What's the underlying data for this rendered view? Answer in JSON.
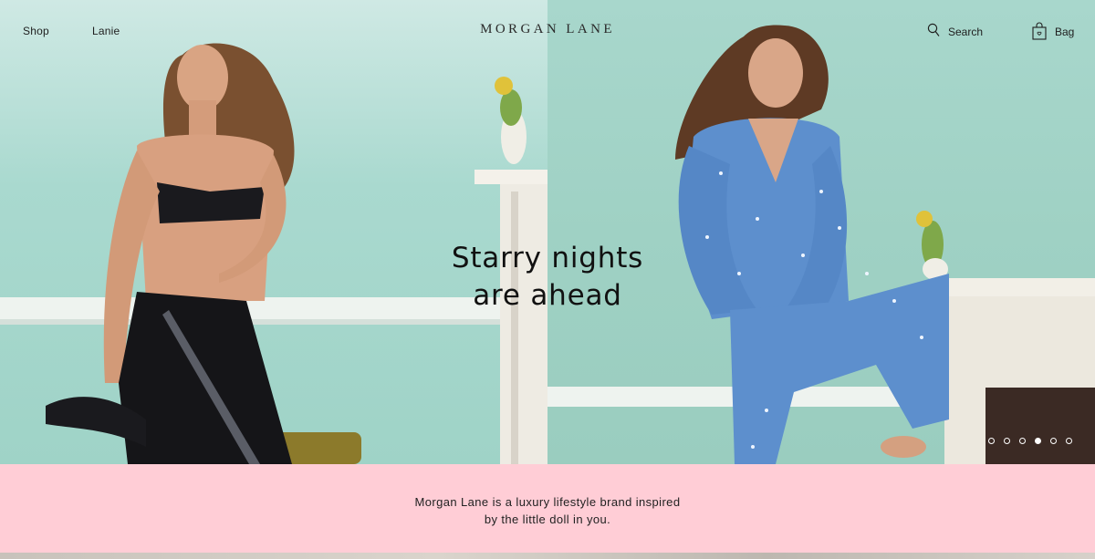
{
  "nav": {
    "shop_label": "Shop",
    "lanie_label": "Lanie",
    "logo_text": "MORGAN LANE",
    "search_label": "Search",
    "bag_label": "Bag",
    "search_icon": "search-icon",
    "bag_icon": "bag-icon"
  },
  "hero": {
    "headline_line1": "Starry nights",
    "headline_line2": "are ahead",
    "slide_count": 6,
    "active_slide_index": 3
  },
  "intro": {
    "line1": "Morgan Lane is a luxury lifestyle brand inspired",
    "line2": "by the little doll in you."
  },
  "colors": {
    "intro_background": "#ffcdd6",
    "wall_mint": "#a8d8cd",
    "pajama_blue": "#5d8fcd",
    "text_dark": "#111111"
  }
}
